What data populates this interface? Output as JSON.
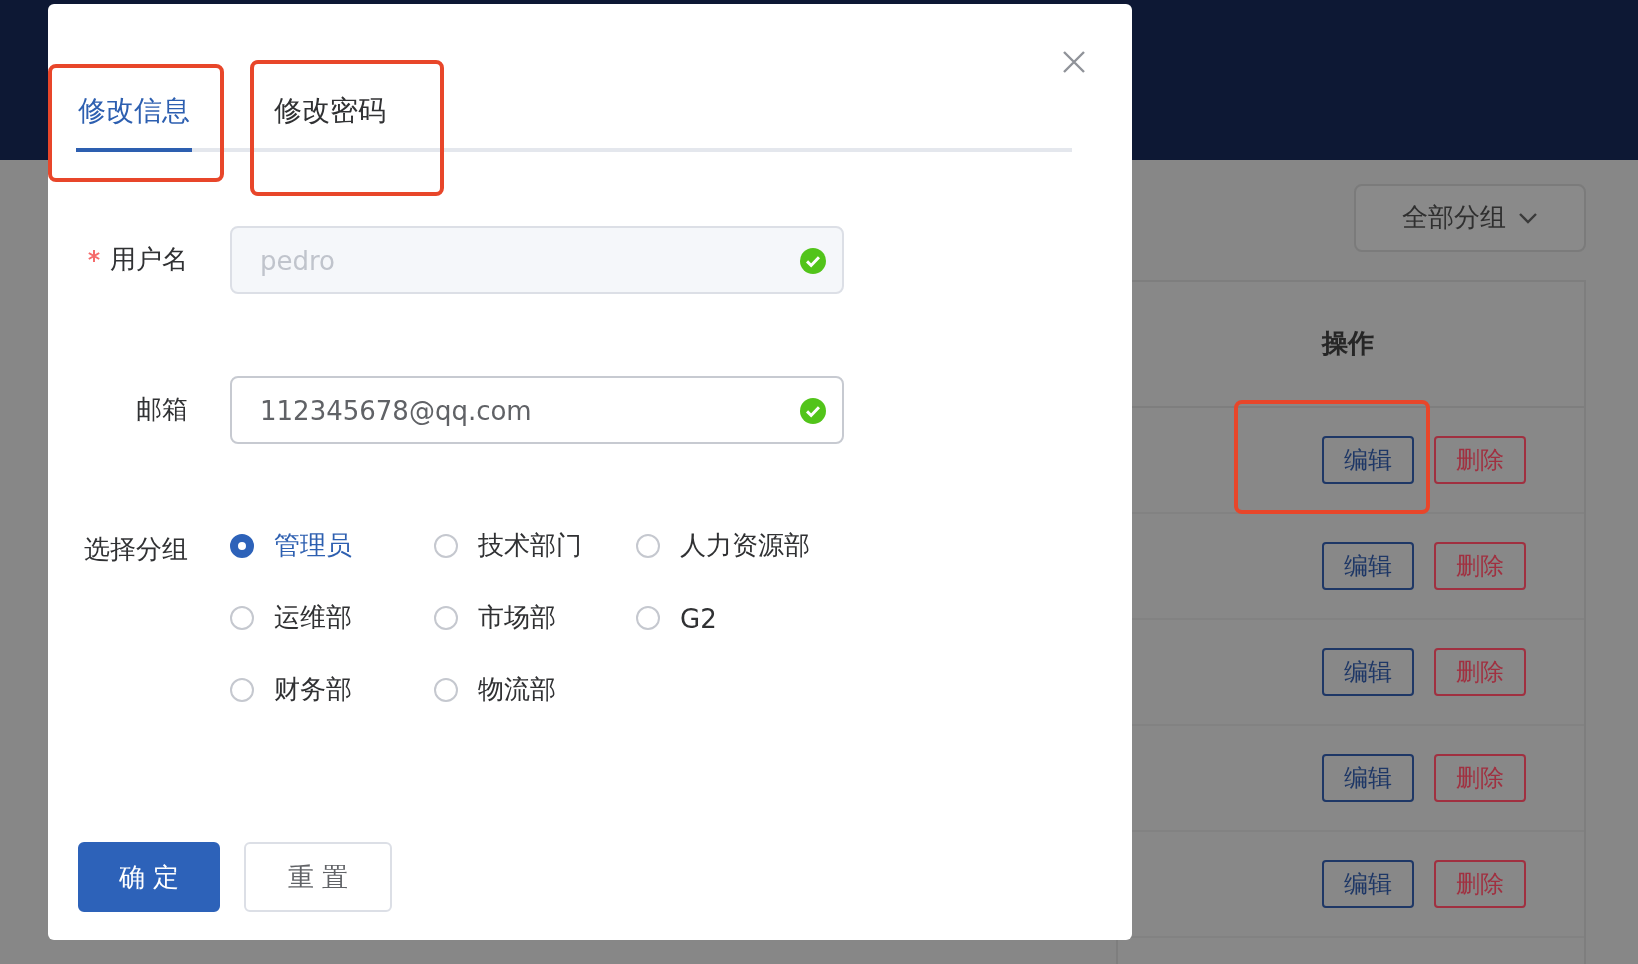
{
  "background": {
    "group_filter": "全部分组",
    "table": {
      "action_header": "操作",
      "rows": [
        {
          "edit": "编辑",
          "delete": "删除"
        },
        {
          "edit": "编辑",
          "delete": "删除"
        },
        {
          "edit": "编辑",
          "delete": "删除"
        },
        {
          "edit": "编辑",
          "delete": "删除"
        },
        {
          "edit": "编辑",
          "delete": "删除"
        }
      ]
    }
  },
  "dialog": {
    "tabs": [
      {
        "label": "修改信息",
        "selected": true
      },
      {
        "label": "修改密码",
        "selected": false
      }
    ],
    "fields": [
      {
        "label": "用户名",
        "required": true,
        "value": "pedro",
        "disabled": true,
        "valid": true
      },
      {
        "label": "邮箱",
        "required": false,
        "value": "112345678@qq.com",
        "disabled": false,
        "valid": true
      }
    ],
    "group": {
      "label": "选择分组",
      "options": [
        {
          "label": "管理员",
          "selected": true
        },
        {
          "label": "技术部门",
          "selected": false
        },
        {
          "label": "人力资源部",
          "selected": false
        },
        {
          "label": "运维部",
          "selected": false
        },
        {
          "label": "市场部",
          "selected": false
        },
        {
          "label": "G2",
          "selected": false
        },
        {
          "label": "财务部",
          "selected": false
        },
        {
          "label": "物流部",
          "selected": false
        }
      ]
    },
    "buttons": [
      {
        "label": "确 定",
        "kind": "primary"
      },
      {
        "label": "重 置",
        "kind": "default"
      }
    ]
  }
}
